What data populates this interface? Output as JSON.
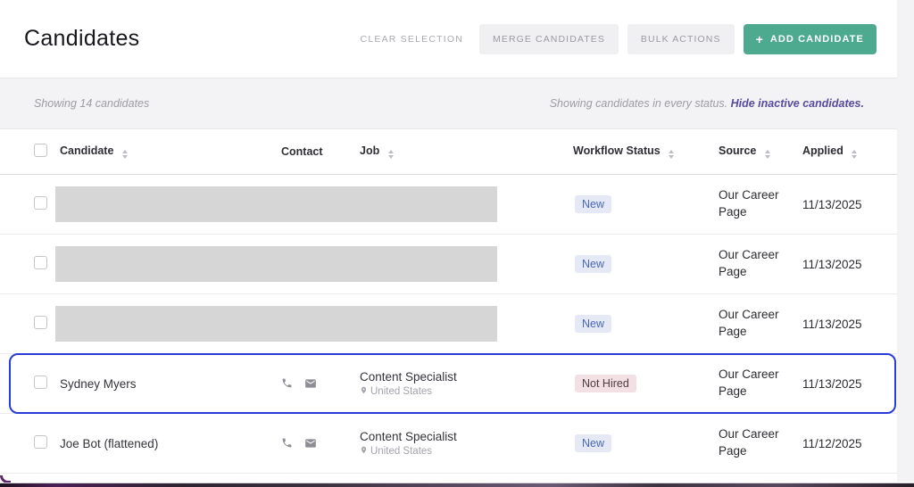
{
  "header": {
    "title": "Candidates",
    "clear_selection_label": "CLEAR SELECTION",
    "merge_candidates_label": "MERGE CANDIDATES",
    "bulk_actions_label": "BULK ACTIONS",
    "add_candidate_plus": "+",
    "add_candidate_label": "ADD CANDIDATE"
  },
  "summary_bar": {
    "results_text": "Showing 14 candidates",
    "status_text": "Showing candidates in every status. ",
    "hide_inactive_link": "Hide inactive candidates",
    "link_suffix": "."
  },
  "table": {
    "columns": [
      {
        "label": "Candidate",
        "sortable": true
      },
      {
        "label": "Contact",
        "sortable": false
      },
      {
        "label": "Job",
        "sortable": true
      },
      {
        "label": "Workflow Status",
        "sortable": true
      },
      {
        "label": "Source",
        "sortable": true
      },
      {
        "label": "Applied",
        "sortable": true
      }
    ],
    "rows": [
      {
        "redacted": true,
        "name": "",
        "status": "New",
        "status_type": "new",
        "source": "Our Career Page",
        "applied": "11/13/2025",
        "selected": false
      },
      {
        "redacted": true,
        "name": "",
        "status": "New",
        "status_type": "new",
        "source": "Our Career Page",
        "applied": "11/13/2025",
        "selected": false
      },
      {
        "redacted": true,
        "name": "",
        "status": "New",
        "status_type": "new",
        "source": "Our Career Page",
        "applied": "11/13/2025",
        "selected": false
      },
      {
        "redacted": false,
        "name": "Sydney Myers",
        "job_title": "Content Specialist",
        "job_location": "United States",
        "status": "Not Hired",
        "status_type": "not-hired",
        "source": "Our Career Page",
        "applied": "11/13/2025",
        "selected": true
      },
      {
        "redacted": false,
        "name": "Joe Bot (flattened)",
        "job_title": "Content Specialist",
        "job_location": "United States",
        "status": "New",
        "status_type": "new",
        "source": "Our Career Page",
        "applied": "11/12/2025",
        "selected": false
      }
    ]
  },
  "icons": {
    "plus-icon": "+",
    "sort-icon": "stacked up/down triangles",
    "phone-icon": "phone handset glyph",
    "email-icon": "envelope glyph",
    "location-pin-icon": "map pin glyph",
    "checkbox": "rounded square outline"
  },
  "colors": {
    "accent_green": "#4daa8e",
    "selected_row_border": "#2b3bd7",
    "link_purple": "#584a9e",
    "badge_new_bg": "#e4e9f5",
    "badge_new_text": "#4a66c0",
    "badge_not_hired_bg": "#f2e0e5",
    "badge_not_hired_text": "#4e3c42",
    "redacted_block": "#d6d6d6",
    "summary_bar_bg": "#f3f3f5"
  }
}
